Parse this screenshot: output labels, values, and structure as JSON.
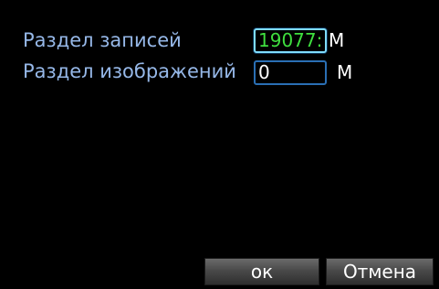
{
  "dialog": {
    "rows": [
      {
        "label": "Раздел записей",
        "value": "19077:",
        "unit": "M"
      },
      {
        "label": "Раздел изображений",
        "value": "0",
        "unit": "M"
      }
    ],
    "buttons": {
      "ok_label": "ок",
      "cancel_label": "Отмена"
    }
  },
  "colors": {
    "background": "#000000",
    "label_text": "#96b8e8",
    "active_value_text": "#3fdf3f",
    "field_border": "#2a6fb4",
    "active_field_border": "#7fdcff"
  }
}
